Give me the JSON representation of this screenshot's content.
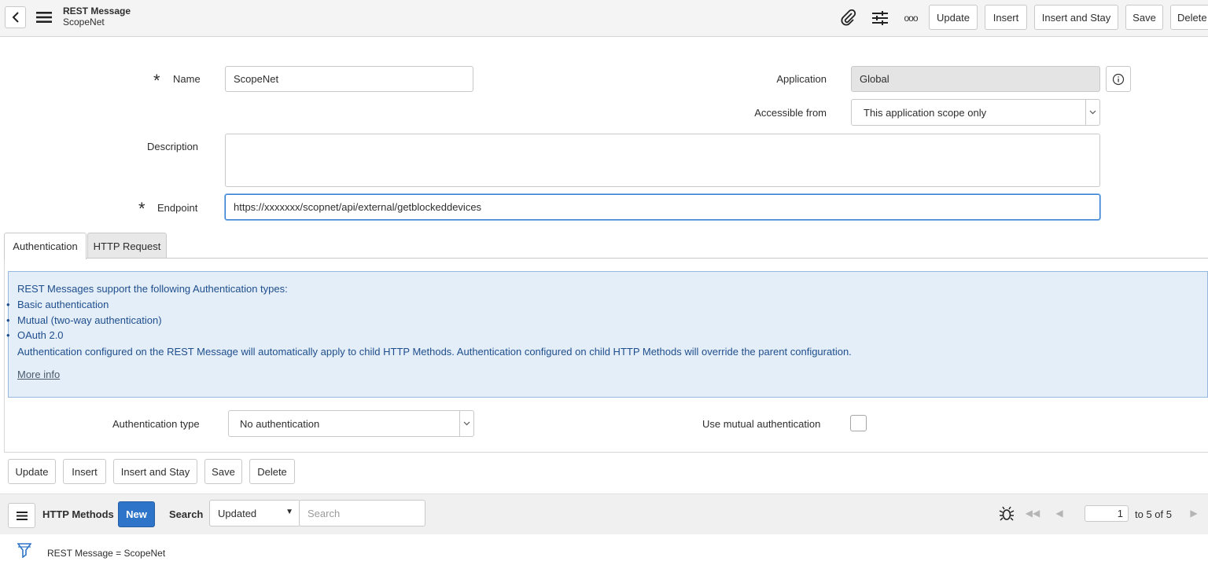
{
  "header": {
    "title": "REST Message",
    "subtitle": "ScopeNet",
    "buttons": {
      "update": "Update",
      "insert": "Insert",
      "insert_and_stay": "Insert and Stay",
      "save": "Save",
      "delete": "Delete"
    },
    "more_label": "ooo"
  },
  "form": {
    "name_label": "Name",
    "name_value": "ScopeNet",
    "application_label": "Application",
    "application_value": "Global",
    "accessible_label": "Accessible from",
    "accessible_value": "This application scope only",
    "description_label": "Description",
    "description_value": "",
    "endpoint_label": "Endpoint",
    "endpoint_value": "https://xxxxxxx/scopnet/api/external/getblockeddevices"
  },
  "tabs": [
    {
      "label": "Authentication"
    },
    {
      "label": "HTTP Request"
    }
  ],
  "info": {
    "heading": "REST Messages support the following Authentication types:",
    "items": [
      "Basic authentication",
      "Mutual (two-way authentication)",
      "OAuth 2.0"
    ],
    "note": "Authentication configured on the REST Message will automatically apply to child HTTP Methods. Authentication configured on child HTTP Methods will override the parent configuration.",
    "more_info": "More info"
  },
  "auth": {
    "type_label": "Authentication type",
    "type_value": "No authentication",
    "mutual_label": "Use mutual authentication",
    "mutual_checked": false
  },
  "bottom_buttons": {
    "update": "Update",
    "insert": "Insert",
    "insert_and_stay": "Insert and Stay",
    "save": "Save",
    "delete": "Delete"
  },
  "related_list": {
    "title": "HTTP Methods",
    "new_label": "New",
    "search_label": "Search",
    "search_field": "Updated",
    "search_placeholder": "Search",
    "page_value": "1",
    "page_total": "to 5 of 5",
    "filter_text": "REST Message = ScopeNet"
  },
  "colors": {
    "primary": "#2e74c8",
    "info_bg": "#e4eef9",
    "info_text": "#1f4e8c"
  }
}
